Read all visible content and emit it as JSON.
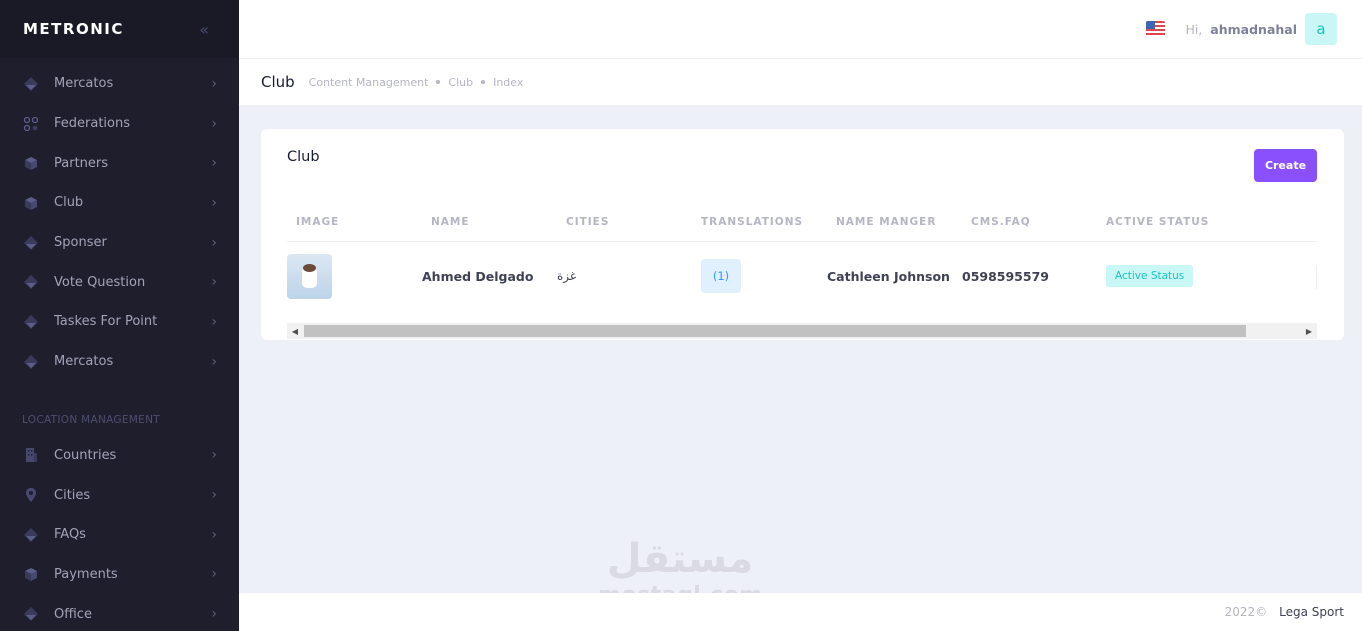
{
  "brand": {
    "logo": "METRONIC",
    "toggle_glyph": "«"
  },
  "sidebar": {
    "items": [
      {
        "label": "Mercatos",
        "icon": "diamond-icon"
      },
      {
        "label": "Federations",
        "icon": "circles-icon"
      },
      {
        "label": "Partners",
        "icon": "box-icon"
      },
      {
        "label": "Club",
        "icon": "box-icon"
      },
      {
        "label": "Sponser",
        "icon": "diamond-icon"
      },
      {
        "label": "Vote Question",
        "icon": "diamond-icon"
      },
      {
        "label": "Taskes For Point",
        "icon": "diamond-icon"
      },
      {
        "label": "Mercatos",
        "icon": "diamond-icon"
      }
    ],
    "section_title": "LOCATION MANAGEMENT",
    "location_items": [
      {
        "label": "Countries",
        "icon": "building-icon"
      },
      {
        "label": "Cities",
        "icon": "map-pin-icon"
      },
      {
        "label": "FAQs",
        "icon": "diamond-icon"
      },
      {
        "label": "Payments",
        "icon": "box-icon"
      },
      {
        "label": "Office",
        "icon": "diamond-icon"
      }
    ],
    "arrow_glyph": "›"
  },
  "header": {
    "greeting": "Hi,",
    "username": "ahmadnahal",
    "avatar_letter": "a",
    "flag_icon": "us-flag-icon"
  },
  "subheader": {
    "title": "Club",
    "breadcrumbs": [
      "Content Management",
      "Club",
      "Index"
    ]
  },
  "card": {
    "title": "Club",
    "create_label": "Create",
    "columns": [
      "IMAGE",
      "NAME",
      "CITIES",
      "TRANSLATIONS",
      "NAME MANGER",
      "CMS.FAQ",
      "ACTIVE STATUS"
    ],
    "rows": [
      {
        "name": "Ahmed Delgado",
        "city": "غزة",
        "translations": "(1)",
        "manager": "Cathleen Johnson",
        "faq": "0598595579",
        "status": "Active Status"
      }
    ]
  },
  "footer": {
    "copyright": "2022©",
    "link": "Lega Sport"
  },
  "watermark": {
    "arabic": "مستقل",
    "latin": "mostaql.com"
  },
  "colors": {
    "sidebar_bg": "#1e1e2d",
    "primary": "#8950fc",
    "info": "#3699ff",
    "success": "#1bc5bd"
  }
}
